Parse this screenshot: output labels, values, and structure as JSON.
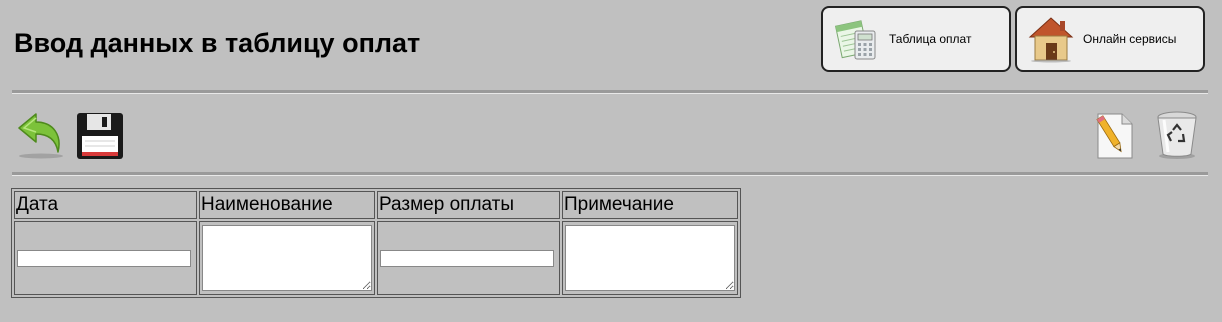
{
  "header": {
    "title": "Ввод данных в таблицу оплат"
  },
  "nav": {
    "payments_table_label": "Таблица оплат",
    "online_services_label": "Онлайн сервисы"
  },
  "toolbar": {
    "icons": [
      "back-arrow-icon",
      "floppy-save-icon",
      "edit-document-icon",
      "recycle-bin-icon"
    ]
  },
  "table": {
    "columns": [
      "Дата",
      "Наименование",
      "Размер оплаты",
      "Примечание"
    ],
    "values": {
      "date": "",
      "name": "",
      "amount": "",
      "note": ""
    }
  },
  "colors": {
    "background": "#c0c0c0",
    "button_background": "#efefef"
  }
}
